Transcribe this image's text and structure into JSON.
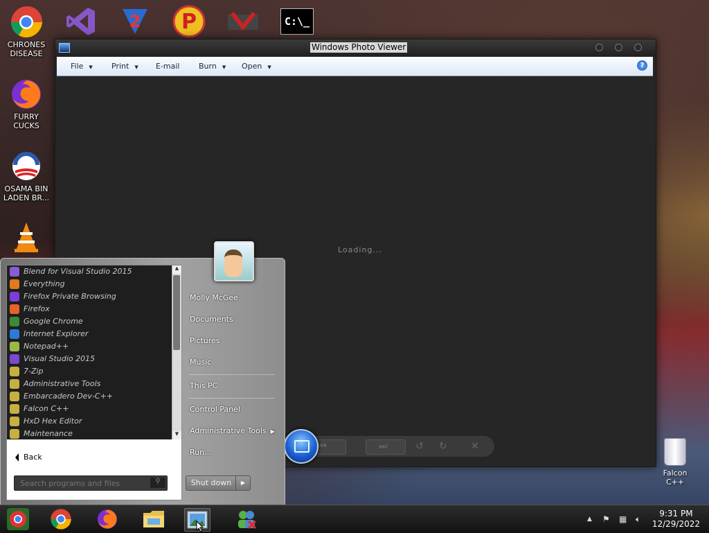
{
  "desktop": {
    "icons": [
      {
        "label": "CHRONES DISEASE"
      },
      {
        "label": "FURRY CUCKS"
      },
      {
        "label": "OSAMA BIN LADEN BR..."
      }
    ],
    "recycle_label": "Falcon C++"
  },
  "top_icons": [
    {
      "icon": "chrome-icon"
    },
    {
      "icon": "visual-studio-icon"
    },
    {
      "icon": "v2-icon"
    },
    {
      "icon": "p-icon"
    },
    {
      "icon": "winrar-icon"
    },
    {
      "icon": "command-prompt-icon",
      "label": "C:\\_"
    }
  ],
  "viewer": {
    "title": "Windows Photo Viewer",
    "menu": {
      "file": "File",
      "print": "Print",
      "email": "E-mail",
      "burn": "Burn",
      "open": "Open",
      "help": "?"
    },
    "loading": "Loading..."
  },
  "start_menu": {
    "programs": [
      {
        "label": "Blend for Visual Studio 2015",
        "color": "#8a5bd6"
      },
      {
        "label": "Everything",
        "color": "#e07a1a"
      },
      {
        "label": "Firefox Private Browsing",
        "color": "#7b3fd6"
      },
      {
        "label": "Firefox",
        "color": "#e5622a"
      },
      {
        "label": "Google Chrome",
        "color": "#3a8a3a"
      },
      {
        "label": "Internet Explorer",
        "color": "#2a7ad6"
      },
      {
        "label": "Notepad++",
        "color": "#9ab84a"
      },
      {
        "label": "Visual Studio 2015",
        "color": "#7a4ad0"
      },
      {
        "label": "7-Zip",
        "color": "#c8b040"
      },
      {
        "label": "Administrative Tools",
        "color": "#c8b040"
      },
      {
        "label": "Embarcadero Dev-C++",
        "color": "#c8b040"
      },
      {
        "label": "Falcon C++",
        "color": "#c8b040"
      },
      {
        "label": "HxD Hex Editor",
        "color": "#c8b040"
      },
      {
        "label": "Maintenance",
        "color": "#c8b040"
      }
    ],
    "back": "Back",
    "search_placeholder": "Search programs and files",
    "right": {
      "user": "Molly McGee",
      "documents": "Documents",
      "pictures": "Pictures",
      "music": "Music",
      "this_pc": "This PC",
      "control_panel": "Control Panel",
      "admin_tools": "Administrative Tools",
      "run": "Run..."
    },
    "shutdown": "Shut down"
  },
  "taskbar": {
    "time": "9:31 PM",
    "date": "12/29/2022"
  }
}
